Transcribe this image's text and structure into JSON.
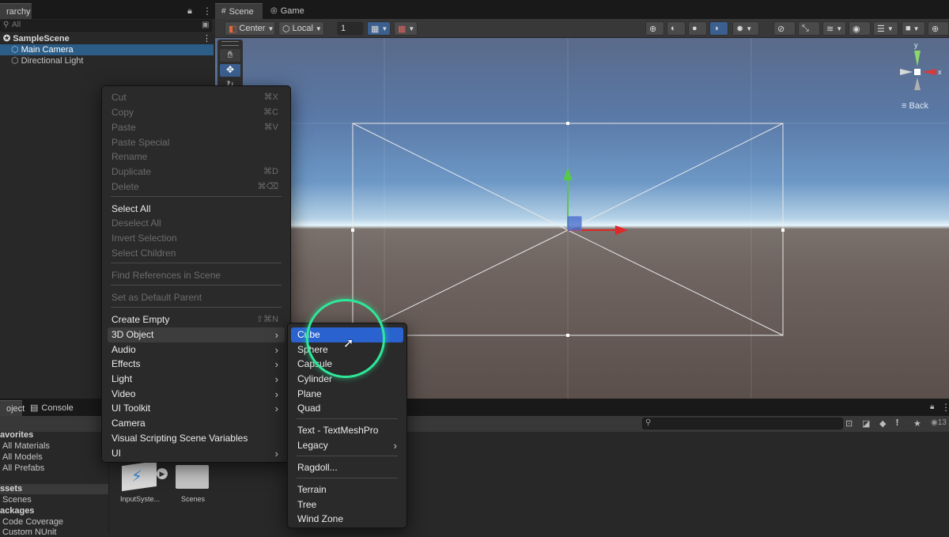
{
  "hierarchy": {
    "tab": "rarchy",
    "search_placeholder": "All",
    "scene": "SampleScene",
    "items": [
      "Main Camera",
      "Directional Light"
    ]
  },
  "scene_tabs": {
    "scene": "Scene",
    "game": "Game"
  },
  "toolbar": {
    "pivot": "Center",
    "space": "Local",
    "snap_value": "1"
  },
  "gizmo": {
    "back": "Back",
    "x": "x"
  },
  "context_menu": {
    "cut": "Cut",
    "cut_sc": "⌘X",
    "copy": "Copy",
    "copy_sc": "⌘C",
    "paste": "Paste",
    "paste_sc": "⌘V",
    "paste_special": "Paste Special",
    "rename": "Rename",
    "duplicate": "Duplicate",
    "duplicate_sc": "⌘D",
    "delete": "Delete",
    "delete_sc": "⌘⌫",
    "select_all": "Select All",
    "deselect_all": "Deselect All",
    "invert_selection": "Invert Selection",
    "select_children": "Select Children",
    "find_references": "Find References in Scene",
    "set_default_parent": "Set as Default Parent",
    "create_empty": "Create Empty",
    "create_empty_sc": "⇧⌘N",
    "object_3d": "3D Object",
    "audio": "Audio",
    "effects": "Effects",
    "light": "Light",
    "video": "Video",
    "ui_toolkit": "UI Toolkit",
    "camera": "Camera",
    "visual_scripting": "Visual Scripting Scene Variables",
    "ui": "UI"
  },
  "submenu": {
    "cube": "Cube",
    "sphere": "Sphere",
    "capsule": "Capsule",
    "cylinder": "Cylinder",
    "plane": "Plane",
    "quad": "Quad",
    "textmeshpro": "Text - TextMeshPro",
    "legacy": "Legacy",
    "ragdoll": "Ragdoll...",
    "terrain": "Terrain",
    "tree": "Tree",
    "wind_zone": "Wind Zone"
  },
  "bottom": {
    "project_tab": "oject",
    "console_tab": "Console",
    "count": "13",
    "favorites": "avorites",
    "fav_items": [
      "All Materials",
      "All Models",
      "All Prefabs"
    ],
    "assets": "ssets",
    "asset_items": [
      "Scenes"
    ],
    "packages": "ackages",
    "package_items": [
      "Code Coverage",
      "Custom NUnit"
    ],
    "files": [
      "InputSyste...",
      "Scenes"
    ]
  }
}
